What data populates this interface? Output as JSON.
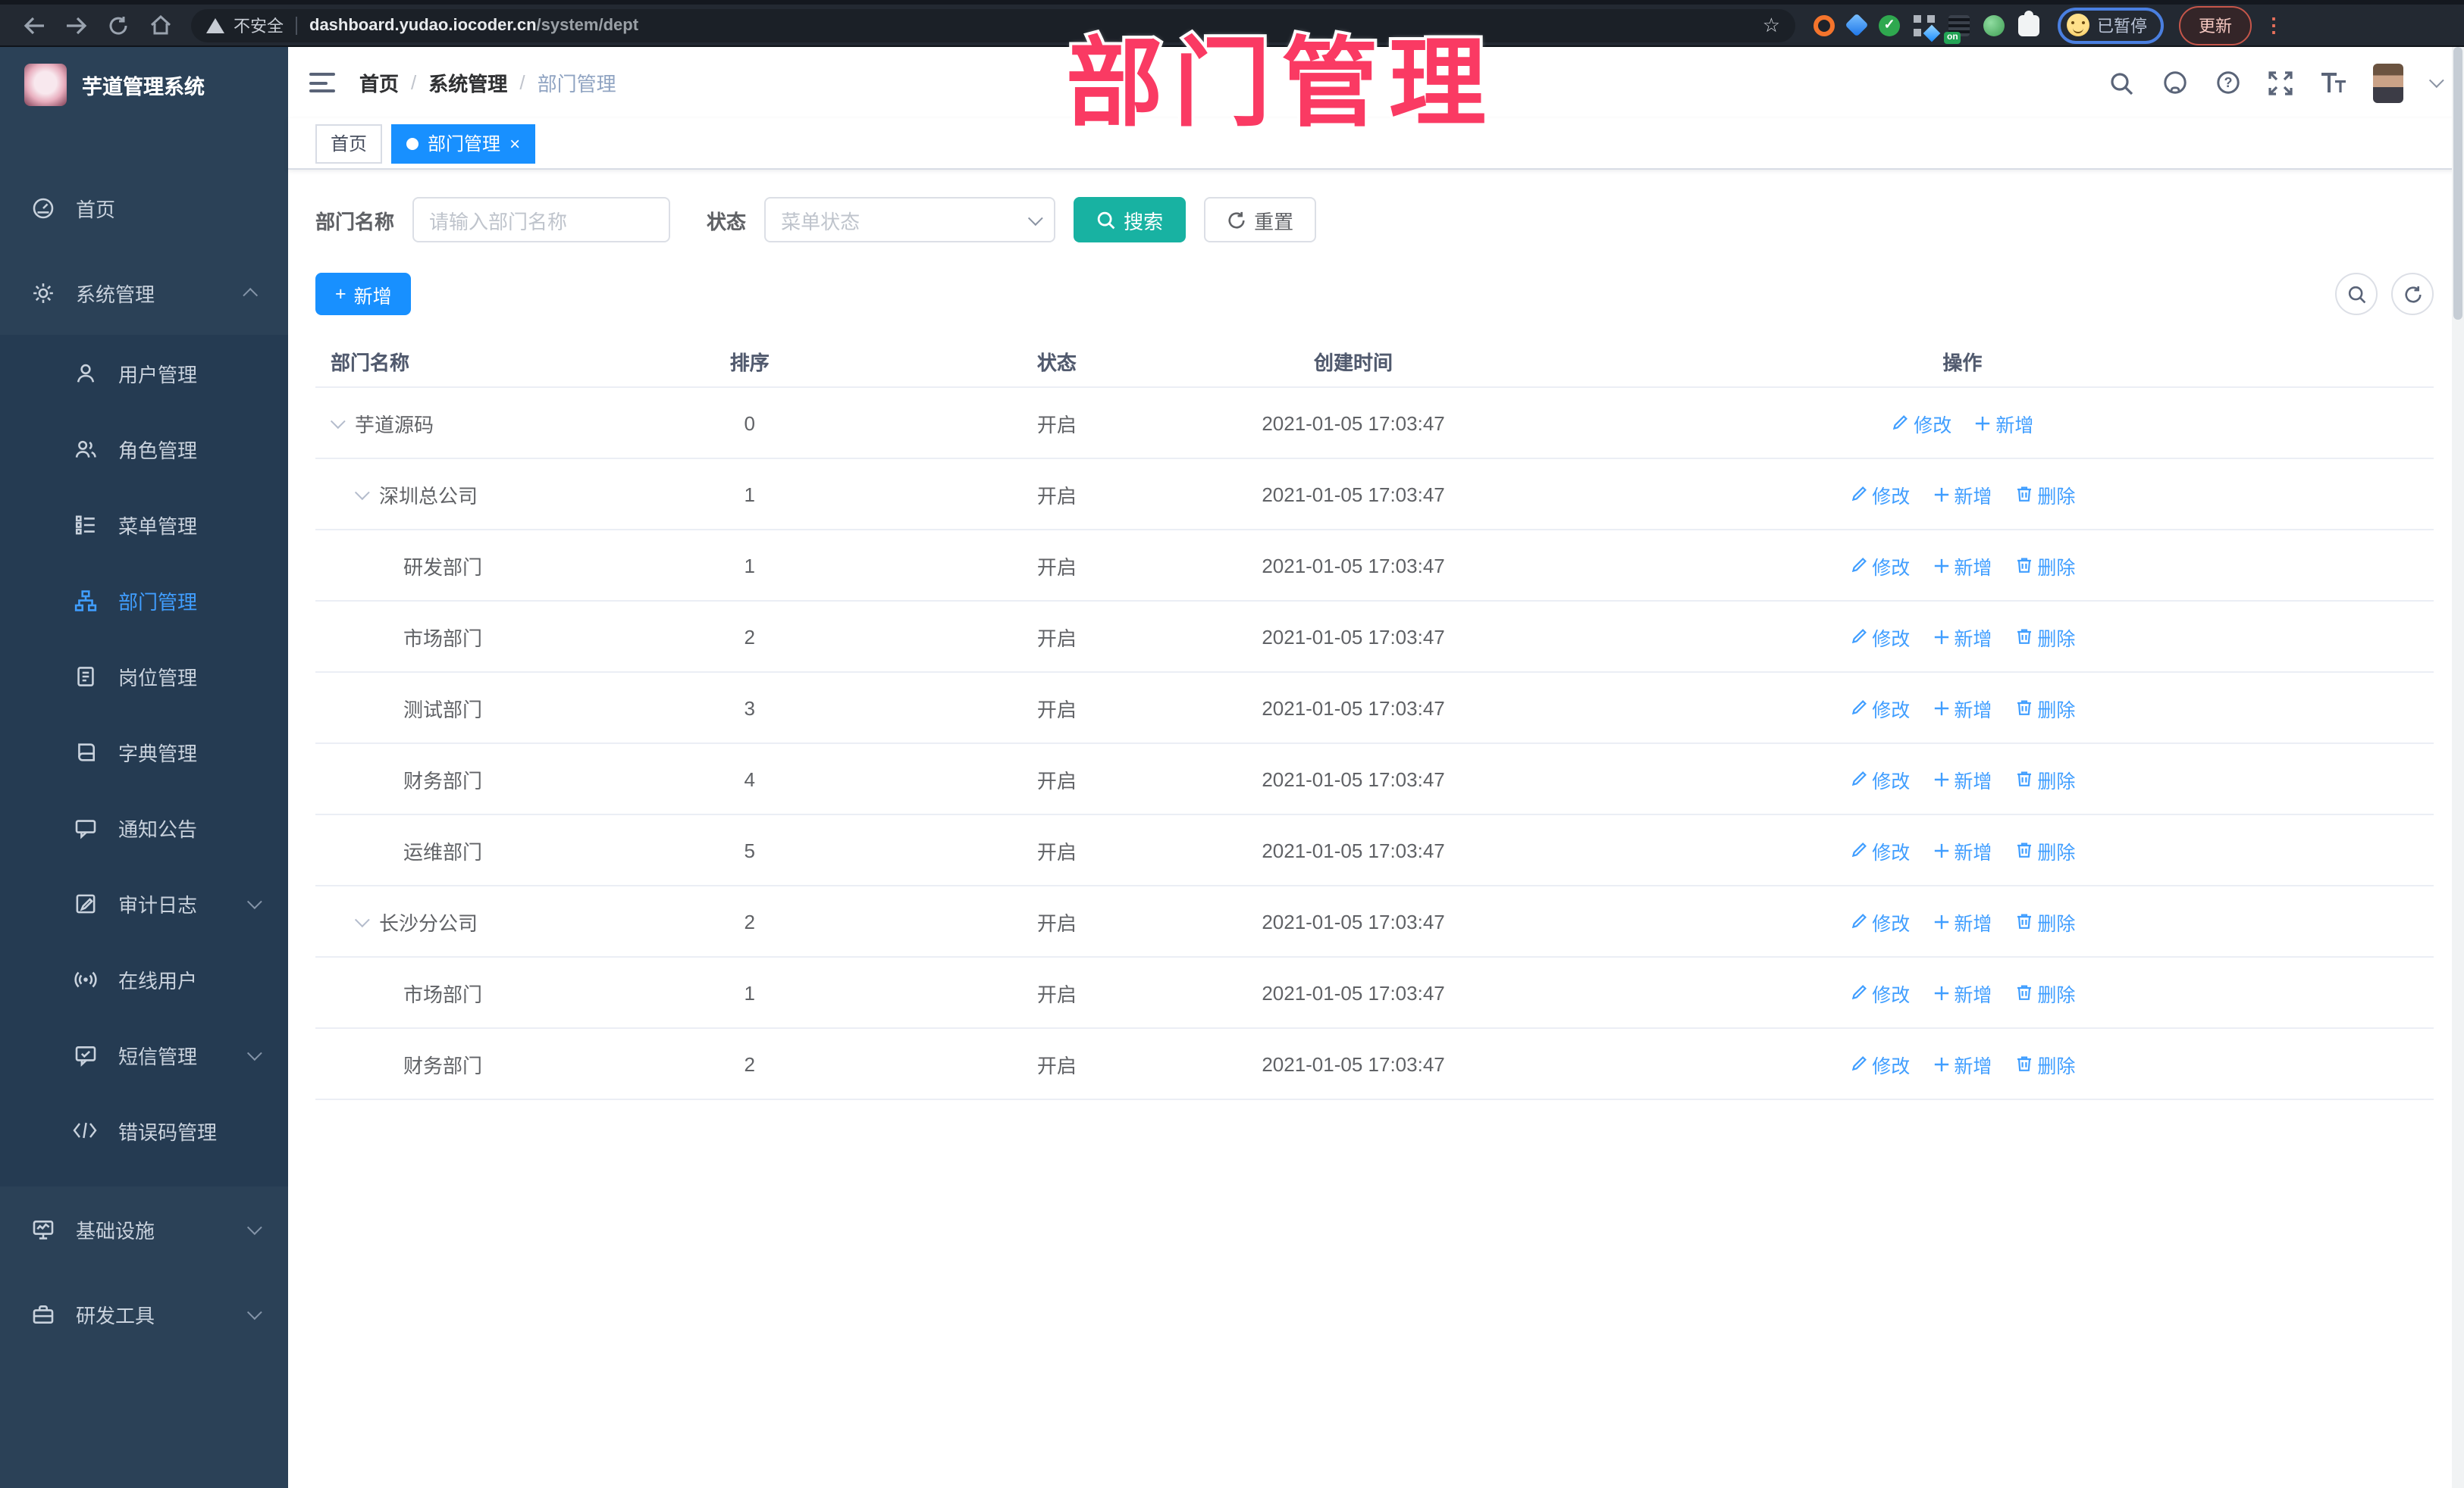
{
  "browser": {
    "nav_icons": [
      "back-icon",
      "forward-icon",
      "reload-icon",
      "home-icon"
    ],
    "address": {
      "security_label": "不安全",
      "url_host": "dashboard.yudao.iocoder.cn",
      "url_path": "/system/dept",
      "bookmark_icon": "star-icon"
    },
    "extensions": [
      "orange-ring-extension",
      "blue-gem-extension",
      "green-check-extension",
      "grid-extension",
      "on-badge-extension",
      "green-frog-extension",
      "puzzle-extension"
    ],
    "on_badge": "on",
    "profile": {
      "label": "已暂停",
      "avatar": "emoji-face"
    },
    "update_label": "更新",
    "kebab_icon": "kebab-menu-icon"
  },
  "watermark": {
    "text": "部门管理",
    "color": "#fa3a63"
  },
  "sidebar": {
    "logo_title": "芋道管理系统",
    "items": [
      {
        "label": "首页",
        "icon": "dashboard",
        "type": "root",
        "chevron": ""
      },
      {
        "label": "系统管理",
        "icon": "gear",
        "type": "root",
        "chevron": "up"
      },
      {
        "label": "用户管理",
        "icon": "user",
        "type": "sub",
        "chevron": ""
      },
      {
        "label": "角色管理",
        "icon": "users",
        "type": "sub",
        "chevron": ""
      },
      {
        "label": "菜单管理",
        "icon": "tree",
        "type": "sub",
        "chevron": ""
      },
      {
        "label": "部门管理",
        "icon": "org",
        "type": "sub",
        "chevron": "",
        "active": true
      },
      {
        "label": "岗位管理",
        "icon": "badge",
        "type": "sub",
        "chevron": ""
      },
      {
        "label": "字典管理",
        "icon": "book",
        "type": "sub",
        "chevron": ""
      },
      {
        "label": "通知公告",
        "icon": "notice",
        "type": "sub",
        "chevron": ""
      },
      {
        "label": "审计日志",
        "icon": "log",
        "type": "sub",
        "chevron": "down"
      },
      {
        "label": "在线用户",
        "icon": "broadcast",
        "type": "sub",
        "chevron": ""
      },
      {
        "label": "短信管理",
        "icon": "sms",
        "type": "sub",
        "chevron": "down"
      },
      {
        "label": "错误码管理",
        "icon": "code",
        "type": "sub",
        "chevron": ""
      },
      {
        "label": "基础设施",
        "icon": "infra",
        "type": "root",
        "chevron": "down"
      },
      {
        "label": "研发工具",
        "icon": "toolbox",
        "type": "root",
        "chevron": "down"
      }
    ]
  },
  "header": {
    "breadcrumb": [
      "首页",
      "系统管理",
      "部门管理"
    ],
    "icons": [
      "search-icon",
      "github-icon",
      "help-icon",
      "fullscreen-icon",
      "font-size-icon",
      "avatar",
      "caret-down-icon"
    ]
  },
  "tags": [
    {
      "label": "首页",
      "active": false
    },
    {
      "label": "部门管理",
      "active": true,
      "close": "×"
    }
  ],
  "filters": {
    "dept_label": "部门名称",
    "dept_placeholder": "请输入部门名称",
    "status_label": "状态",
    "status_placeholder": "菜单状态",
    "search_label": "搜索",
    "reset_label": "重置"
  },
  "toolbar": {
    "add_label": "新增",
    "mini_icons": [
      "search-icon",
      "refresh-icon"
    ]
  },
  "table": {
    "columns": [
      "部门名称",
      "排序",
      "状态",
      "创建时间",
      "操作"
    ],
    "action_labels": {
      "modify": "修改",
      "add": "新增",
      "delete": "删除"
    },
    "rows": [
      {
        "name": "芋道源码",
        "level": 0,
        "expandable": true,
        "sort": "0",
        "status": "开启",
        "created": "2021-01-05 17:03:47",
        "actions": [
          "modify",
          "add"
        ]
      },
      {
        "name": "深圳总公司",
        "level": 1,
        "expandable": true,
        "sort": "1",
        "status": "开启",
        "created": "2021-01-05 17:03:47",
        "actions": [
          "modify",
          "add",
          "delete"
        ]
      },
      {
        "name": "研发部门",
        "level": 2,
        "expandable": false,
        "sort": "1",
        "status": "开启",
        "created": "2021-01-05 17:03:47",
        "actions": [
          "modify",
          "add",
          "delete"
        ]
      },
      {
        "name": "市场部门",
        "level": 2,
        "expandable": false,
        "sort": "2",
        "status": "开启",
        "created": "2021-01-05 17:03:47",
        "actions": [
          "modify",
          "add",
          "delete"
        ]
      },
      {
        "name": "测试部门",
        "level": 2,
        "expandable": false,
        "sort": "3",
        "status": "开启",
        "created": "2021-01-05 17:03:47",
        "actions": [
          "modify",
          "add",
          "delete"
        ]
      },
      {
        "name": "财务部门",
        "level": 2,
        "expandable": false,
        "sort": "4",
        "status": "开启",
        "created": "2021-01-05 17:03:47",
        "actions": [
          "modify",
          "add",
          "delete"
        ]
      },
      {
        "name": "运维部门",
        "level": 2,
        "expandable": false,
        "sort": "5",
        "status": "开启",
        "created": "2021-01-05 17:03:47",
        "actions": [
          "modify",
          "add",
          "delete"
        ]
      },
      {
        "name": "长沙分公司",
        "level": 1,
        "expandable": true,
        "sort": "2",
        "status": "开启",
        "created": "2021-01-05 17:03:47",
        "actions": [
          "modify",
          "add",
          "delete"
        ]
      },
      {
        "name": "市场部门",
        "level": 2,
        "expandable": false,
        "sort": "1",
        "status": "开启",
        "created": "2021-01-05 17:03:47",
        "actions": [
          "modify",
          "add",
          "delete"
        ]
      },
      {
        "name": "财务部门",
        "level": 2,
        "expandable": false,
        "sort": "2",
        "status": "开启",
        "created": "2021-01-05 17:03:47",
        "actions": [
          "modify",
          "add",
          "delete"
        ]
      }
    ]
  },
  "colors": {
    "accent_blue": "#1890ff",
    "menu_active_blue": "#409eff",
    "search_teal": "#18b2a2",
    "watermark_pink": "#fa3a63",
    "sidebar_bg": "#2b4157",
    "submenu_bg": "#25 3b52"
  }
}
